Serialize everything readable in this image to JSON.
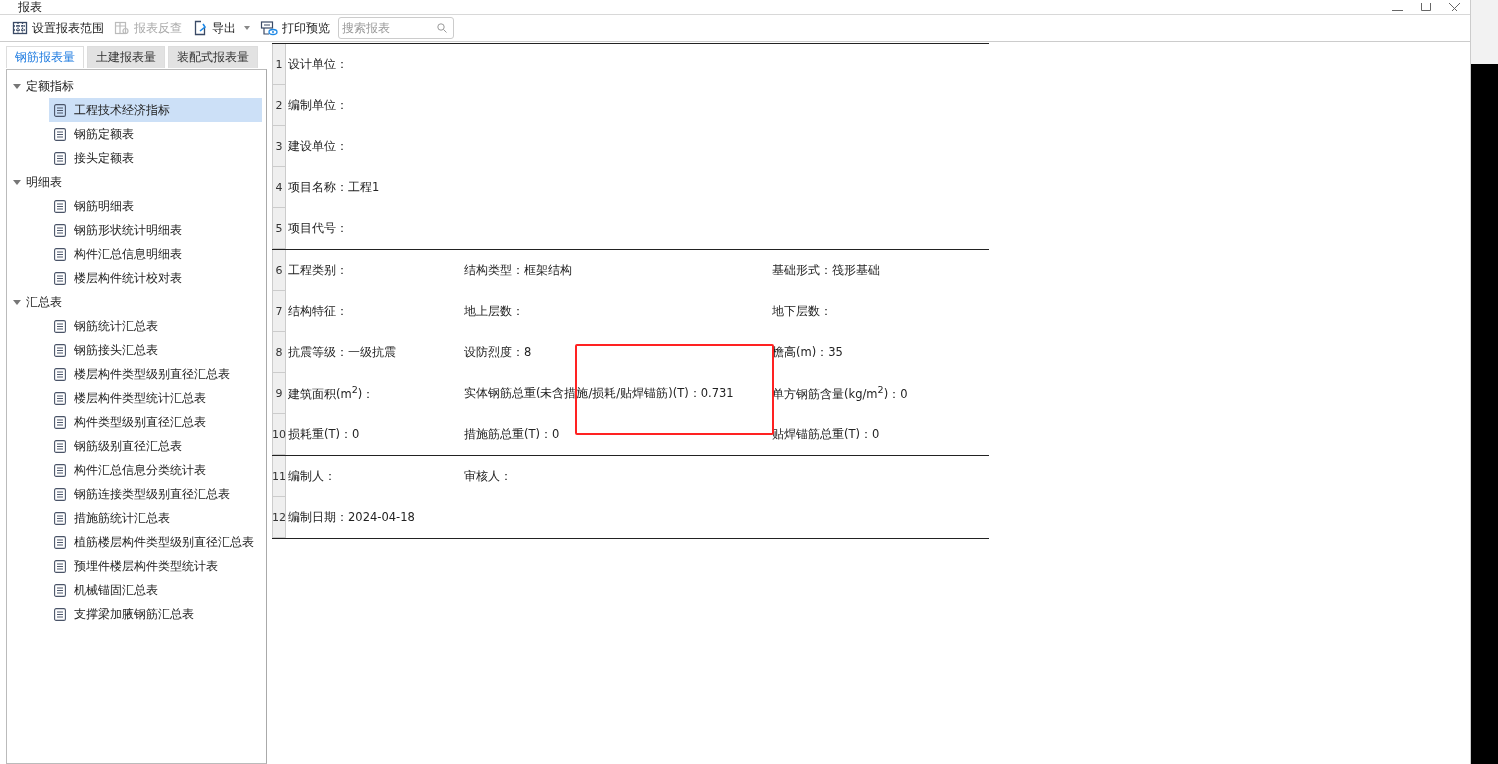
{
  "window": {
    "title": "报表"
  },
  "toolbar": [
    {
      "kind": "range",
      "label": "设置报表范围",
      "disabled": false,
      "has_menu": false
    },
    {
      "kind": "lookup",
      "label": "报表反查",
      "disabled": true,
      "has_menu": false
    },
    {
      "kind": "export",
      "label": "导出",
      "disabled": false,
      "has_menu": true
    },
    {
      "kind": "print",
      "label": "打印预览",
      "disabled": false,
      "has_menu": false
    }
  ],
  "search": {
    "placeholder": "搜索报表"
  },
  "tabs": [
    {
      "label": "钢筋报表量",
      "selected": true
    },
    {
      "label": "土建报表量",
      "selected": false
    },
    {
      "label": "装配式报表量",
      "selected": false
    }
  ],
  "tree": [
    {
      "label": "定额指标",
      "expanded": true,
      "children": [
        {
          "label": "工程技术经济指标",
          "selected": true
        },
        {
          "label": "钢筋定额表",
          "selected": false
        },
        {
          "label": "接头定额表",
          "selected": false
        }
      ]
    },
    {
      "label": "明细表",
      "expanded": true,
      "children": [
        {
          "label": "钢筋明细表",
          "selected": false
        },
        {
          "label": "钢筋形状统计明细表",
          "selected": false
        },
        {
          "label": "构件汇总信息明细表",
          "selected": false
        },
        {
          "label": "楼层构件统计校对表",
          "selected": false
        }
      ]
    },
    {
      "label": "汇总表",
      "expanded": true,
      "children": [
        {
          "label": "钢筋统计汇总表",
          "selected": false
        },
        {
          "label": "钢筋接头汇总表",
          "selected": false
        },
        {
          "label": "楼层构件类型级别直径汇总表",
          "selected": false
        },
        {
          "label": "楼层构件类型统计汇总表",
          "selected": false
        },
        {
          "label": "构件类型级别直径汇总表",
          "selected": false
        },
        {
          "label": "钢筋级别直径汇总表",
          "selected": false
        },
        {
          "label": "构件汇总信息分类统计表",
          "selected": false
        },
        {
          "label": "钢筋连接类型级别直径汇总表",
          "selected": false
        },
        {
          "label": "措施筋统计汇总表",
          "selected": false
        },
        {
          "label": "植筋楼层构件类型级别直径汇总表",
          "selected": false
        },
        {
          "label": "预埋件楼层构件类型统计表",
          "selected": false
        },
        {
          "label": "机械锚固汇总表",
          "selected": false
        },
        {
          "label": "支撑梁加腋钢筋汇总表",
          "selected": false
        }
      ]
    }
  ],
  "report": {
    "sections": [
      {
        "rows": [
          {
            "number": "1",
            "cells": [
              "设计单位："
            ]
          },
          {
            "number": "2",
            "cells": [
              "编制单位："
            ]
          },
          {
            "number": "3",
            "cells": [
              "建设单位："
            ]
          },
          {
            "number": "4",
            "cells": [
              "项目名称：工程1"
            ]
          },
          {
            "number": "5",
            "cells": [
              "项目代号："
            ]
          }
        ]
      },
      {
        "rows": [
          {
            "number": "6",
            "cells": [
              "工程类别：",
              "结构类型：框架结构",
              "基础形式：筏形基础"
            ]
          },
          {
            "number": "7",
            "cells": [
              "结构特征：",
              "地上层数：",
              "地下层数："
            ]
          },
          {
            "number": "8",
            "cells": [
              "抗震等级：一级抗震",
              "设防烈度：8",
              "檐高(m)：35"
            ]
          },
          {
            "number": "9",
            "cells": [
              "建筑面积(m$^{2}$)：",
              "实体钢筋总重(未含措施/损耗/贴焊锚筋)(T)：0.731",
              "单方钢筋含量(kg/m$^{2}$)：0"
            ]
          },
          {
            "number": "10",
            "cells": [
              "损耗重(T)：0",
              "措施筋总重(T)：0",
              "贴焊锚筋总重(T)：0"
            ]
          }
        ]
      },
      {
        "rows": [
          {
            "number": "11",
            "cells": [
              "编制人：",
              "审核人："
            ]
          },
          {
            "number": "12",
            "cells": [
              "编制日期：2024-04-18"
            ]
          }
        ]
      }
    ]
  }
}
